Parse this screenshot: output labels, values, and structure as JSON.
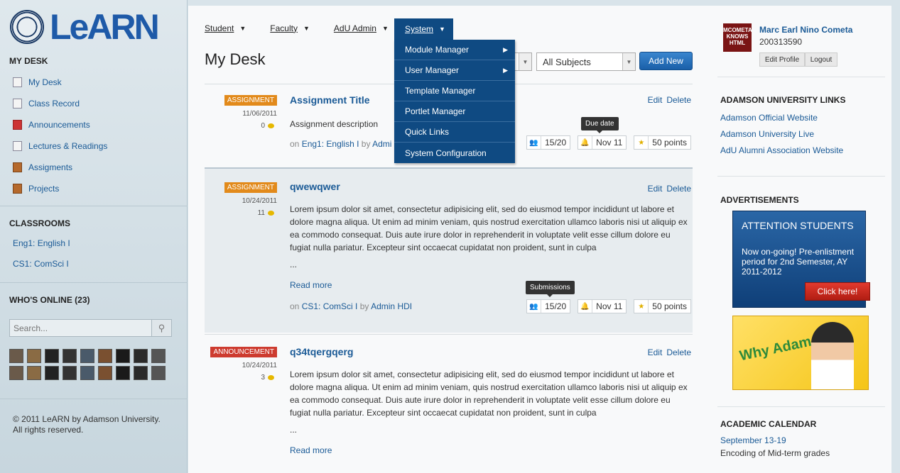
{
  "brand": {
    "name": "LeARN"
  },
  "sidebar": {
    "my_desk_heading": "MY DESK",
    "nav": [
      {
        "label": "My Desk",
        "icon": "page-icon"
      },
      {
        "label": "Class Record",
        "icon": "page-icon"
      },
      {
        "label": "Announcements",
        "icon": "megaphone-icon"
      },
      {
        "label": "Lectures & Readings",
        "icon": "page-icon"
      },
      {
        "label": "Assigments",
        "icon": "book-icon"
      },
      {
        "label": "Projects",
        "icon": "book-icon"
      }
    ],
    "classrooms_heading": "CLASSROOMS",
    "classrooms": [
      "Eng1: English I",
      "CS1: ComSci I"
    ],
    "whos_online_heading": "WHO'S ONLINE (23)",
    "search_placeholder": "Search...",
    "online_avatar_count": 18,
    "copyright_line1": "© 2011 LeARN by Adamson University.",
    "copyright_line2": "All rights reserved."
  },
  "topnav": {
    "items": [
      "Student",
      "Faculty",
      "AdU Admin"
    ],
    "system": "System",
    "dropdown": [
      {
        "label": "Module Manager",
        "submenu": true
      },
      {
        "label": "User Manager",
        "submenu": true
      },
      {
        "label": "Template Manager",
        "submenu": false
      },
      {
        "label": "Portlet Manager",
        "submenu": false
      },
      {
        "label": "Quick Links",
        "submenu": false
      },
      {
        "label": "System Configuration",
        "submenu": false
      }
    ]
  },
  "main": {
    "title": "My Desk",
    "subjects_select": "All Subjects",
    "add_new": "Add New"
  },
  "posts": [
    {
      "badge": "ASSIGNMENT",
      "badge_type": "assignment",
      "date": "11/06/2011",
      "comments": "0",
      "title": "Assignment Title",
      "body": "Assignment description",
      "meta_on": "on",
      "course": "Eng1: English I",
      "meta_by": "by",
      "author": "Admi",
      "submissions": "15/20",
      "due": "Nov 11",
      "points": "50 points",
      "edit": "Edit",
      "delete": "Delete"
    },
    {
      "badge": "ASSIGNMENT",
      "badge_type": "assignment",
      "date": "10/24/2011",
      "comments": "11",
      "title": "qwewqwer",
      "body": "Lorem ipsum dolor sit amet, consectetur adipisicing elit, sed do eiusmod tempor incididunt ut labore et dolore magna aliqua. Ut enim ad minim veniam, quis nostrud exercitation ullamco laboris nisi ut aliquip ex ea commodo consequat. Duis aute irure dolor in reprehenderit in voluptate velit esse cillum dolore eu fugiat nulla pariatur. Excepteur sint occaecat cupidatat non proident, sunt in culpa",
      "ellipsis": "...",
      "read_more": "Read more",
      "meta_on": "on",
      "course": "CS1: ComSci I",
      "meta_by": "by",
      "author": "Admin HDI",
      "submissions": "15/20",
      "due": "Nov 11",
      "points": "50 points",
      "edit": "Edit",
      "delete": "Delete"
    },
    {
      "badge": "ANNOUNCEMENT",
      "badge_type": "announcement",
      "date": "10/24/2011",
      "comments": "3",
      "title": "q34tqergqerg",
      "body": "Lorem ipsum dolor sit amet, consectetur adipisicing elit, sed do eiusmod tempor incididunt ut labore et dolore magna aliqua. Ut enim ad minim veniam, quis nostrud exercitation ullamco laboris nisi ut aliquip ex ea commodo consequat. Duis aute irure dolor in reprehenderit in voluptate velit esse cillum dolore eu fugiat nulla pariatur. Excepteur sint occaecat cupidatat non proident, sunt in culpa",
      "ellipsis": "...",
      "read_more": "Read more",
      "edit": "Edit",
      "delete": "Delete"
    }
  ],
  "tooltips": {
    "due": "Due date",
    "submissions": "Submissions"
  },
  "user": {
    "name": "Marc Earl Nino Cometa",
    "id": "200313590",
    "avatar_text": "MCOMETA KNOWS HTML",
    "edit_profile": "Edit Profile",
    "logout": "Logout"
  },
  "links": {
    "heading": "ADAMSON UNIVERSITY LINKS",
    "items": [
      "Adamson Official Website",
      "Adamson University Live",
      "AdU Alumni Association Website"
    ]
  },
  "ads": {
    "heading": "ADVERTISEMENTS",
    "title": "ATTENTION STUDENTS",
    "body": "Now on-going! Pre-enlistment period for 2nd Semester, AY 2011-2012",
    "button": "Click here!",
    "why_text": "Why Adamson?"
  },
  "calendar": {
    "heading": "ACADEMIC CALENDAR",
    "date": "September 13-19",
    "desc": "Encoding of Mid-term grades"
  },
  "colors": {
    "accent": "#1a5a96",
    "menu_bg": "#0f4a82",
    "assignment": "#e28a1b",
    "announcement": "#cd3b2f"
  }
}
